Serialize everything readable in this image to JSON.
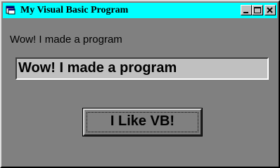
{
  "window": {
    "title": "My Visual Basic Program",
    "system_icon": "window-icon",
    "controls": {
      "minimize_icon": "minimize-icon",
      "maximize_icon": "maximize-icon",
      "close_icon": "close-icon"
    }
  },
  "form": {
    "label_text": "Wow! I made a program",
    "textbox_value": "Wow! I made a program",
    "button_label": "I Like VB!"
  },
  "colors": {
    "titlebar": "#00ffff",
    "form_background": "#808080",
    "textbox_background": "#c0c0c0"
  }
}
